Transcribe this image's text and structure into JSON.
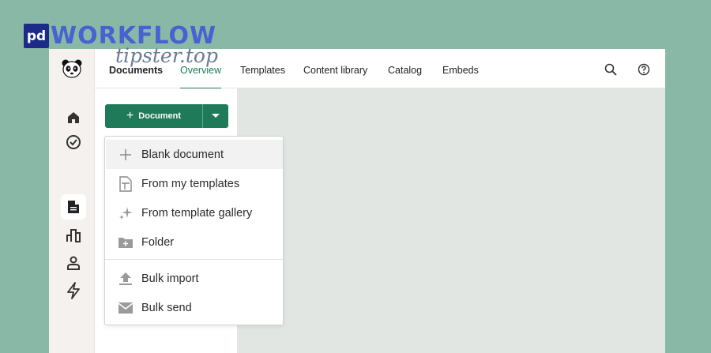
{
  "watermark": {
    "logo": "pd",
    "text": "WORKFLOW",
    "sub": "tipster.top"
  },
  "nav": {
    "tabs": [
      {
        "label": "Documents"
      },
      {
        "label": "Overview"
      },
      {
        "label": "Templates"
      },
      {
        "label": "Content library"
      },
      {
        "label": "Catalog"
      },
      {
        "label": "Embeds"
      }
    ],
    "active_tab": "Overview"
  },
  "toolbar": {
    "new_document_label": "Document"
  },
  "menu": {
    "items": [
      {
        "label": "Blank document",
        "icon": "plus-icon"
      },
      {
        "label": "From my templates",
        "icon": "template-icon"
      },
      {
        "label": "From template gallery",
        "icon": "sparkle-icon"
      },
      {
        "label": "Folder",
        "icon": "folder-plus-icon"
      },
      {
        "label": "Bulk import",
        "icon": "upload-icon"
      },
      {
        "label": "Bulk send",
        "icon": "envelope-icon"
      }
    ]
  },
  "colors": {
    "accent": "#1f7a59",
    "background": "#8ab8a6",
    "content_bg": "#e1e6e3",
    "rail_bg": "#f4f1ee"
  }
}
